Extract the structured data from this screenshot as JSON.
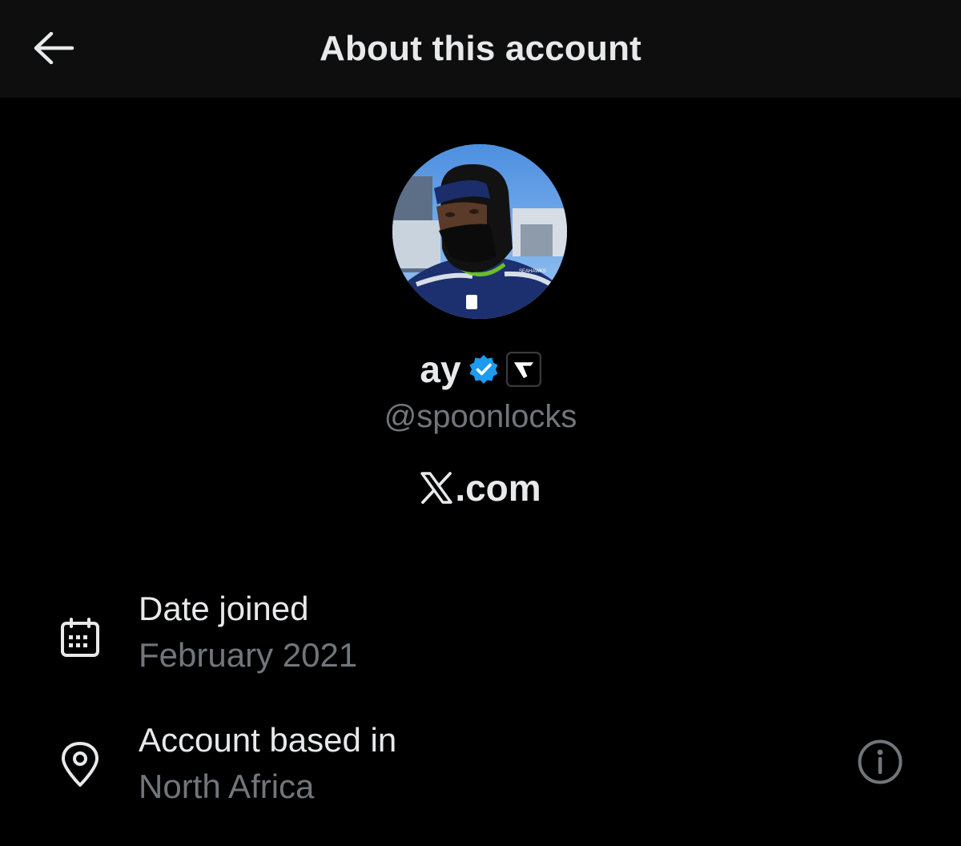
{
  "header": {
    "title": "About this account",
    "back_icon": "arrow-left-icon"
  },
  "profile": {
    "display_name": "ay",
    "verified_badge_icon": "verified-badge-icon",
    "verified_badge_color": "#1d9bf0",
    "affiliate_badge_icon": "affiliate-badge-icon",
    "handle": "@spoonlocks",
    "avatar_icon": "profile-avatar",
    "avatar_jersey_text": "SEAHAWKS"
  },
  "connection": {
    "logo_icon": "x-logo-icon",
    "label": ".com"
  },
  "details": {
    "date_joined": {
      "icon": "calendar-icon",
      "title": "Date joined",
      "value": "February 2021"
    },
    "account_location": {
      "icon": "location-pin-icon",
      "title": "Account based in",
      "value": "North Africa",
      "info_icon": "info-icon"
    }
  },
  "colors": {
    "background": "#000000",
    "header_background": "#0e0e0e",
    "primary_text": "#e7e9ea",
    "secondary_text": "#71767b",
    "accent": "#1d9bf0"
  }
}
